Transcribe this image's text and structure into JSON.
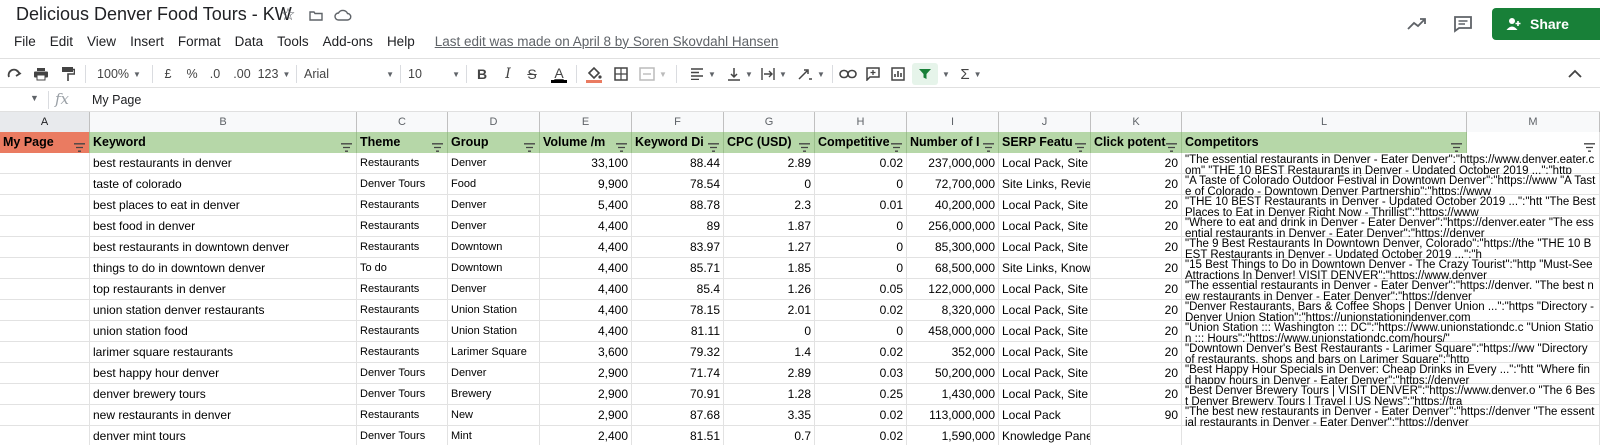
{
  "app": {
    "title": "Delicious Denver Food Tours - KW",
    "last_edit": "Last edit was made on April 8 by Soren Skovdahl Hansen",
    "share_label": "Share"
  },
  "menu": [
    "File",
    "Edit",
    "View",
    "Insert",
    "Format",
    "Data",
    "Tools",
    "Add-ons",
    "Help"
  ],
  "toolbar": {
    "zoom": "100%",
    "currency": "£",
    "percent": "%",
    "decrease_decimals": ".0",
    "increase_decimals": ".00",
    "number_format": "123",
    "font": "Arial",
    "font_size": "10",
    "bold": "B",
    "italic": "I",
    "strikethrough": "S",
    "text_color": "A",
    "functions": "Σ"
  },
  "formula_bar": {
    "fx": "fx",
    "value": "My Page"
  },
  "colors": {
    "header_fill": "#b6d7a8",
    "selected_header_fill": "#ea7b61",
    "share_green": "#188038"
  },
  "sheet": {
    "column_letters": [
      "A",
      "B",
      "C",
      "D",
      "E",
      "F",
      "G",
      "H",
      "I",
      "J",
      "K",
      "L",
      "M"
    ],
    "headers": [
      "My Page",
      "Keyword",
      "Theme",
      "Group",
      "Volume /m",
      "Keyword Di",
      "CPC (USD)",
      "Competitive",
      "Number of I",
      "SERP Featu",
      "Click potent",
      "Competitors",
      ""
    ],
    "rows": [
      {
        "keyword": "best restaurants in denver",
        "theme": "Restaurants",
        "group": "Denver",
        "volume": "33,100",
        "kd": "88.44",
        "cpc": "2.89",
        "comp": "0.02",
        "results": "237,000,000",
        "serp": "Local Pack, Site",
        "click": "20",
        "competitors": "\"The essential restaurants in Denver - Eater Denver\":\"https://www.denver.eater.com\" \"THE 10 BEST Restaurants in Denver - Updated October 2019 ...\":\"http"
      },
      {
        "keyword": "taste of colorado",
        "theme": "Denver Tours",
        "group": "Food",
        "volume": "9,900",
        "kd": "78.54",
        "cpc": "0",
        "comp": "0",
        "results": "72,700,000",
        "serp": "Site Links, Revie",
        "click": "20",
        "competitors": "\"A Taste of Colorado Outdoor Festival in Downtown Denver\":\"https://www \"A Taste of Colorado - Downtown Denver Partnership\":\"https://www"
      },
      {
        "keyword": "best places to eat in denver",
        "theme": "Restaurants",
        "group": "Denver",
        "volume": "5,400",
        "kd": "88.78",
        "cpc": "2.3",
        "comp": "0.01",
        "results": "40,200,000",
        "serp": "Local Pack, Site",
        "click": "20",
        "competitors": "\"THE 10 BEST Restaurants in Denver - Updated October 2019 ...\":\"htt \"The Best Places to Eat in Denver Right Now - Thrillist\":\"https://www"
      },
      {
        "keyword": "best food in denver",
        "theme": "Restaurants",
        "group": "Denver",
        "volume": "4,400",
        "kd": "89",
        "cpc": "1.87",
        "comp": "0",
        "results": "256,000,000",
        "serp": "Local Pack, Site",
        "click": "20",
        "competitors": "\"Where to eat and drink in Denver - Eater Denver\":\"https://denver.eater \"The essential restaurants in Denver - Eater Denver\":\"https://denver"
      },
      {
        "keyword": "best restaurants in downtown denver",
        "theme": "Restaurants",
        "group": "Downtown",
        "volume": "4,400",
        "kd": "83.97",
        "cpc": "1.27",
        "comp": "0",
        "results": "85,300,000",
        "serp": "Local Pack, Site",
        "click": "20",
        "competitors": "\"The 9 Best Restaurants In Downtown Denver, Colorado\":\"https://the \"THE 10 BEST Restaurants in Denver - Updated October 2019 ...\":\"h"
      },
      {
        "keyword": "things to do in downtown denver",
        "theme": "To do",
        "group": "Downtown",
        "volume": "4,400",
        "kd": "85.71",
        "cpc": "1.85",
        "comp": "0",
        "results": "68,500,000",
        "serp": "Site Links, Know",
        "click": "20",
        "competitors": "\"15 Best Things to Do in Downtown Denver - The Crazy Tourist\":\"http \"Must-See Attractions In Denver! VISIT DENVER\":\"https://www.denver"
      },
      {
        "keyword": "top restaurants in denver",
        "theme": "Restaurants",
        "group": "Denver",
        "volume": "4,400",
        "kd": "85.4",
        "cpc": "1.26",
        "comp": "0.05",
        "results": "122,000,000",
        "serp": "Local Pack, Site",
        "click": "20",
        "competitors": "\"The essential restaurants in Denver - Eater Denver\":\"https://denver. \"The best new restaurants in Denver - Eater Denver\":\"https://denver"
      },
      {
        "keyword": "union station denver restaurants",
        "theme": "Restaurants",
        "group": "Union Station",
        "volume": "4,400",
        "kd": "78.15",
        "cpc": "2.01",
        "comp": "0.02",
        "results": "8,320,000",
        "serp": "Local Pack, Site",
        "click": "20",
        "competitors": "\"Denver Restaurants, Bars & Coffee Shops | Denver Union ...\":\"https \"Directory - Denver Union Station\":\"https://unionstationindenver.com"
      },
      {
        "keyword": "union station food",
        "theme": "Restaurants",
        "group": "Union Station",
        "volume": "4,400",
        "kd": "81.11",
        "cpc": "0",
        "comp": "0",
        "results": "458,000,000",
        "serp": "Local Pack, Site",
        "click": "20",
        "competitors": "\"Union Station ::: Washington ::: DC\":\"https://www.unionstationdc.c \"Union Station ::: Hours\":\"https://www.unionstationdc.com/hours/\""
      },
      {
        "keyword": "larimer square restaurants",
        "theme": "Restaurants",
        "group": "Larimer Square",
        "volume": "3,600",
        "kd": "79.32",
        "cpc": "1.4",
        "comp": "0.02",
        "results": "352,000",
        "serp": "Local Pack, Site",
        "click": "20",
        "competitors": "\"Downtown Denver's Best Restaurants - Larimer Square\":\"https://ww \"Directory of restaurants, shops and bars on Larimer Square\":\"http"
      },
      {
        "keyword": "best happy hour denver",
        "theme": "Denver Tours",
        "group": "Denver",
        "volume": "2,900",
        "kd": "71.74",
        "cpc": "2.89",
        "comp": "0.03",
        "results": "50,200,000",
        "serp": "Local Pack, Site",
        "click": "20",
        "competitors": "\"Best Happy Hour Specials in Denver: Cheap Drinks in Every ...\":\"htt \"Where find happy hours in Denver - Eater Denver\":\"https://denver"
      },
      {
        "keyword": "denver brewery tours",
        "theme": "Denver Tours",
        "group": "Brewery",
        "volume": "2,900",
        "kd": "70.91",
        "cpc": "1.28",
        "comp": "0.25",
        "results": "1,430,000",
        "serp": "Local Pack, Site",
        "click": "20",
        "competitors": "\"Best Denver Brewery Tours | VISIT DENVER\":\"https://www.denver.o \"The 6 Best Denver Brewery Tours | Travel | US News\":\"https://tra"
      },
      {
        "keyword": "new restaurants in denver",
        "theme": "Restaurants",
        "group": "New",
        "volume": "2,900",
        "kd": "87.68",
        "cpc": "3.35",
        "comp": "0.02",
        "results": "113,000,000",
        "serp": "Local Pack",
        "click": "90",
        "competitors": "\"The best new restaurants in Denver - Eater Denver\":\"https://denver \"The essential restaurants in Denver - Eater Denver\":\"https://denver"
      },
      {
        "keyword": "denver mint tours",
        "theme": "Denver Tours",
        "group": "Mint",
        "volume": "2,400",
        "kd": "81.51",
        "cpc": "0.7",
        "comp": "0.02",
        "results": "1,590,000",
        "serp": "Knowledge Panel, Top Stories, Reviews",
        "click": "",
        "competitors": ""
      }
    ]
  }
}
